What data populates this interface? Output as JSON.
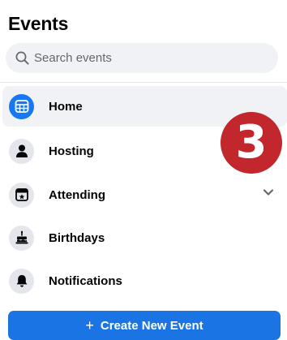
{
  "header": {
    "title": "Events"
  },
  "search": {
    "placeholder": "Search events",
    "value": ""
  },
  "nav": {
    "items": [
      {
        "label": "Home",
        "icon": "calendar-grid-icon",
        "active": true
      },
      {
        "label": "Hosting",
        "icon": "person-icon",
        "active": false
      },
      {
        "label": "Attending",
        "icon": "calendar-star-icon",
        "active": false,
        "expandable": true
      },
      {
        "label": "Birthdays",
        "icon": "birthday-cake-icon",
        "active": false
      },
      {
        "label": "Notifications",
        "icon": "bell-icon",
        "active": false
      }
    ]
  },
  "badge": {
    "text": "3",
    "color": "#c1272d"
  },
  "create_button": {
    "plus": "+",
    "label": "Create New Event"
  },
  "colors": {
    "accent": "#1877f2",
    "button": "#1b74e4",
    "surface": "#f0f2f5",
    "icon_bg": "#e4e6eb",
    "badge": "#c1272d"
  }
}
